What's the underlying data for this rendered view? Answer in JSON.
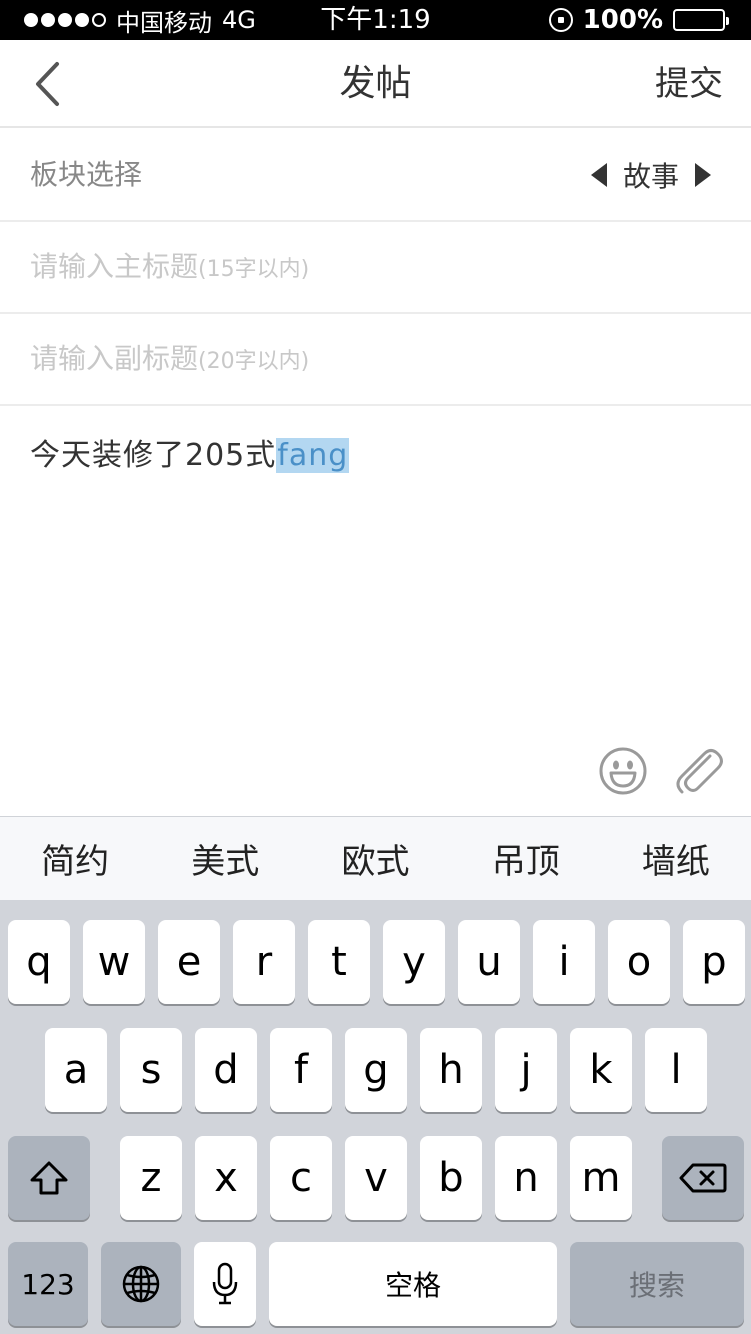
{
  "status_bar": {
    "carrier": "中国移动",
    "network": "4G",
    "time": "下午1:19",
    "battery_text": "100%",
    "signal_filled": 4,
    "signal_total": 5
  },
  "nav": {
    "title": "发帖",
    "submit_label": "提交",
    "back_icon": "chevron-left-icon"
  },
  "board": {
    "label": "板块选择",
    "value": "故事"
  },
  "title_field": {
    "placeholder": "请输入主标题",
    "hint": "(15字以内)"
  },
  "subtitle_field": {
    "placeholder": "请输入副标题",
    "hint": "(20字以内)"
  },
  "content": {
    "committed": "今天装修了205式",
    "composing": "fang"
  },
  "candidates": [
    "简约",
    "美式",
    "欧式",
    "吊顶",
    "墙纸"
  ],
  "keyboard": {
    "row1": [
      "q",
      "w",
      "e",
      "r",
      "t",
      "y",
      "u",
      "i",
      "o",
      "p"
    ],
    "row2": [
      "a",
      "s",
      "d",
      "f",
      "g",
      "h",
      "j",
      "k",
      "l"
    ],
    "row3": [
      "z",
      "x",
      "c",
      "v",
      "b",
      "n",
      "m"
    ],
    "num_label": "123",
    "space_label": "空格",
    "search_label": "搜索"
  },
  "colors": {
    "highlight": "#b3d7f1",
    "keyboard_bg": "#d1d4da",
    "dark_key": "#acb3bd"
  }
}
